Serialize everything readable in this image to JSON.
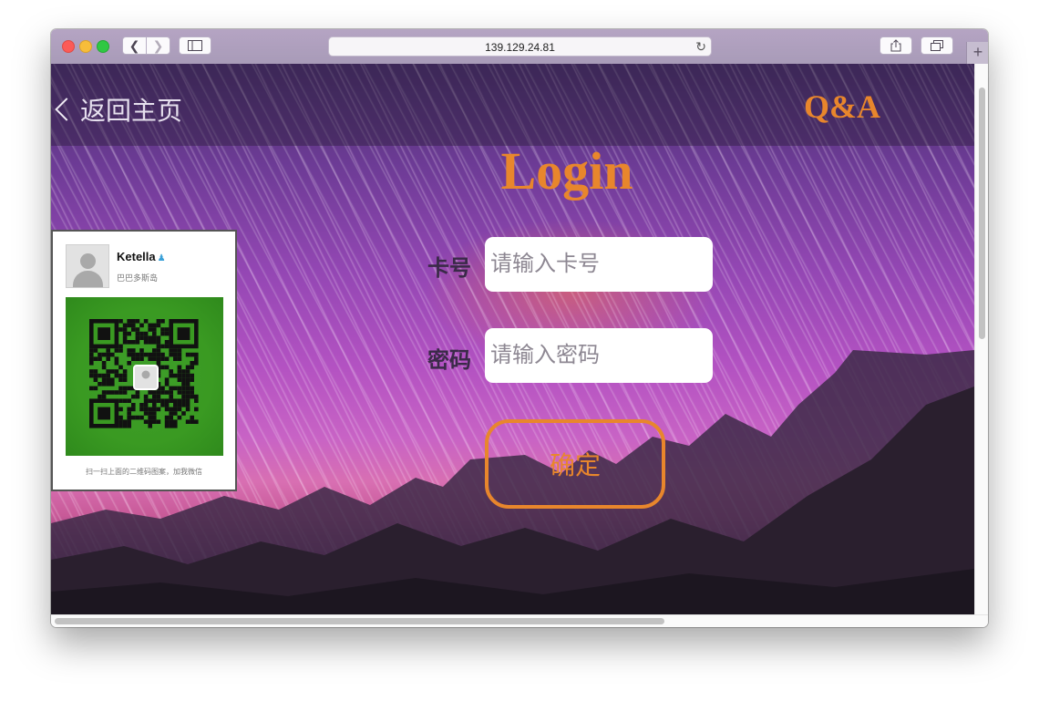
{
  "browser": {
    "url": "139.129.24.81",
    "icons": {
      "back": "chevron-left-icon",
      "forward": "chevron-right-icon",
      "sidebar": "sidebar-icon",
      "reload": "reload-icon",
      "share": "share-icon",
      "tabs": "tabs-icon",
      "new_tab": "plus-icon"
    }
  },
  "page": {
    "back_link": "返回主页",
    "qa_link": "Q&A",
    "title": "Login",
    "card_label": "卡号",
    "card_placeholder": "请输入卡号",
    "card_value": "",
    "password_label": "密码",
    "password_placeholder": "请输入密码",
    "password_value": "",
    "confirm_button": "确定",
    "accent_color": "#e8862c"
  },
  "qr_card": {
    "name": "Ketella",
    "region": "巴巴多斯岛",
    "caption": "扫一扫上面的二维码图案，加我微信",
    "qr_color": "#3a9a22"
  }
}
